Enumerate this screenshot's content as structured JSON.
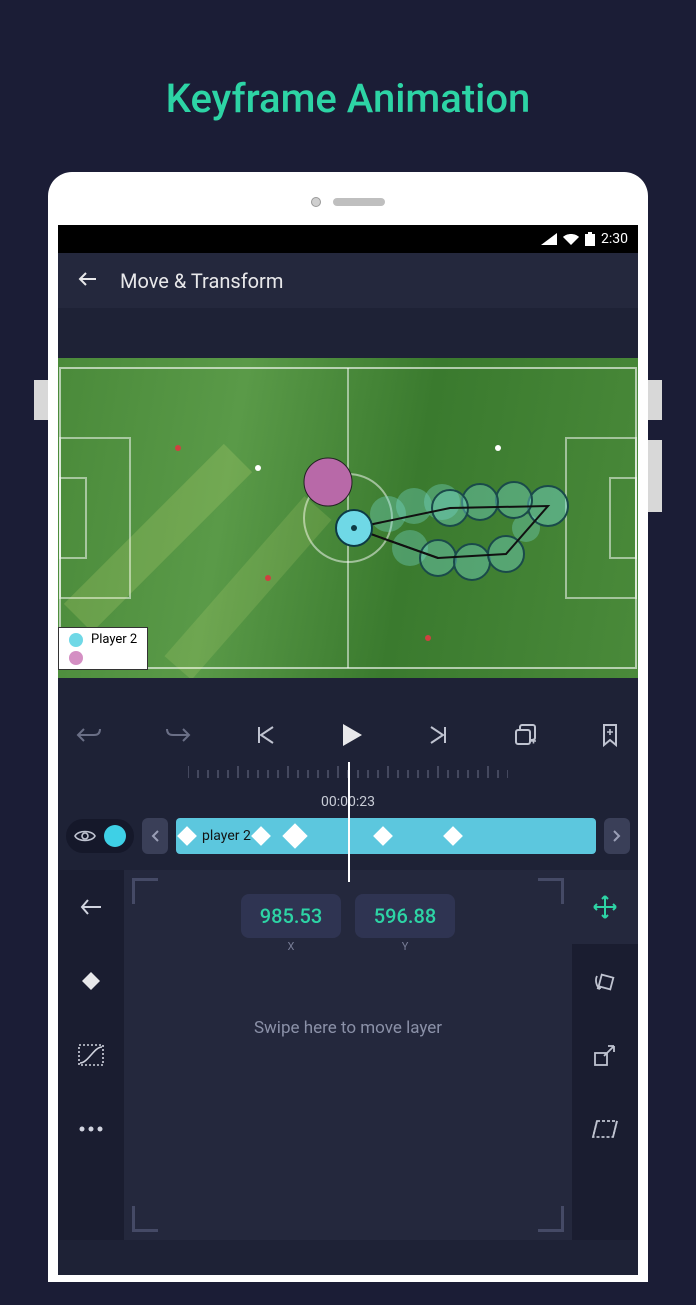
{
  "promo": {
    "title": "Keyframe Animation"
  },
  "status": {
    "time": "2:30"
  },
  "header": {
    "title": "Move & Transform"
  },
  "canvas": {
    "legend": [
      {
        "label": "Player 2",
        "color": "#6fd8e6"
      },
      {
        "label": "",
        "color": "#d48fc3"
      }
    ]
  },
  "timeline": {
    "timecode": "00:00:23",
    "track_label": "player 2"
  },
  "transform": {
    "x": "985.53",
    "y": "596.88",
    "x_label": "X",
    "y_label": "Y",
    "hint": "Swipe here to move layer"
  }
}
